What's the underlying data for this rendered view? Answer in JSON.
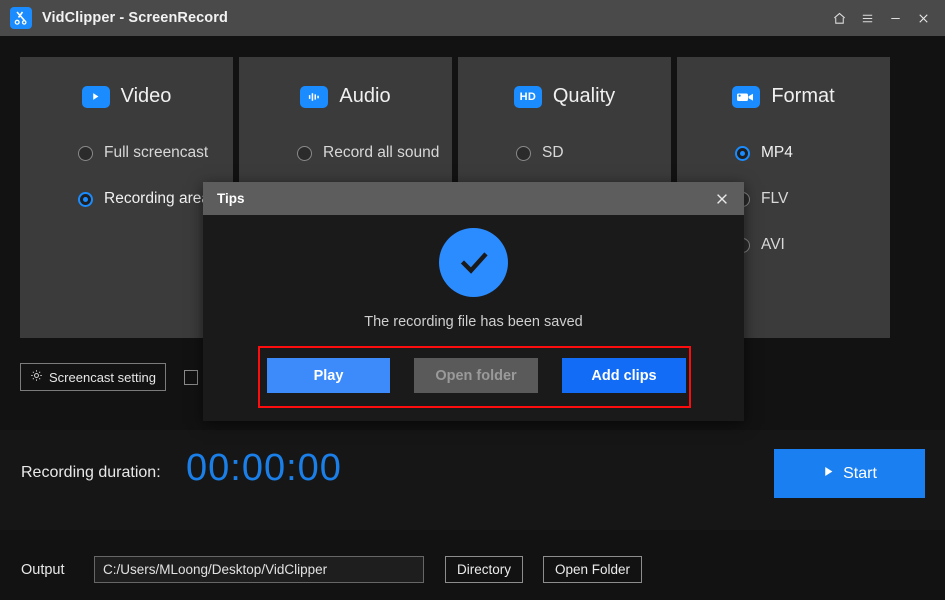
{
  "window": {
    "title": "VidClipper - ScreenRecord",
    "icon": "scissors-app-icon",
    "controls": [
      {
        "name": "home-icon",
        "glyph": "⌂"
      },
      {
        "name": "menu-icon",
        "glyph": "≡"
      },
      {
        "name": "minimize-icon",
        "glyph": "−"
      },
      {
        "name": "close-icon",
        "glyph": "✕"
      }
    ]
  },
  "panels": [
    {
      "title": "Video",
      "icon": "video-play-icon",
      "options": [
        {
          "label": "Full screencast",
          "selected": false
        },
        {
          "label": "Recording area",
          "selected": true
        }
      ]
    },
    {
      "title": "Audio",
      "icon": "audio-waveform-icon",
      "options": [
        {
          "label": "Record all sound",
          "selected": false
        }
      ]
    },
    {
      "title": "Quality",
      "icon": "hd-icon",
      "icon_text": "HD",
      "options": [
        {
          "label": "SD",
          "selected": false
        }
      ]
    },
    {
      "title": "Format",
      "icon": "camcorder-icon",
      "options": [
        {
          "label": "MP4",
          "selected": true
        },
        {
          "label": "FLV",
          "selected": false
        },
        {
          "label": "AVI",
          "selected": false
        }
      ]
    }
  ],
  "settings": {
    "screencast_setting_label": "Screencast setting",
    "gear_icon": "gear-icon",
    "checkbox_checked": false
  },
  "duration": {
    "label": "Recording duration:",
    "value": "00:00:00",
    "accent_color": "#1a7fe8"
  },
  "start_button": {
    "label": "Start",
    "icon": "play-triangle-icon",
    "color": "#1a7ff0"
  },
  "output": {
    "label": "Output",
    "path": "C:/Users/MLoong/Desktop/VidClipper",
    "placeholder": "C:/Users/MLoong/Desktop/VidClipper",
    "directory_button": "Directory",
    "open_folder_button": "Open Folder"
  },
  "dialog": {
    "title": "Tips",
    "close_icon": "close-icon",
    "status_icon": "checkmark-circle-icon",
    "status_color": "#2b8cff",
    "message": "The recording file has been saved",
    "highlight_color": "#fd0d0d",
    "buttons": [
      {
        "label": "Play",
        "state": "enabled",
        "color": "#3d8bfb"
      },
      {
        "label": "Open folder",
        "state": "disabled",
        "color": "#5a5a5a"
      },
      {
        "label": "Add clips",
        "state": "enabled",
        "color": "#136cf5"
      }
    ]
  }
}
